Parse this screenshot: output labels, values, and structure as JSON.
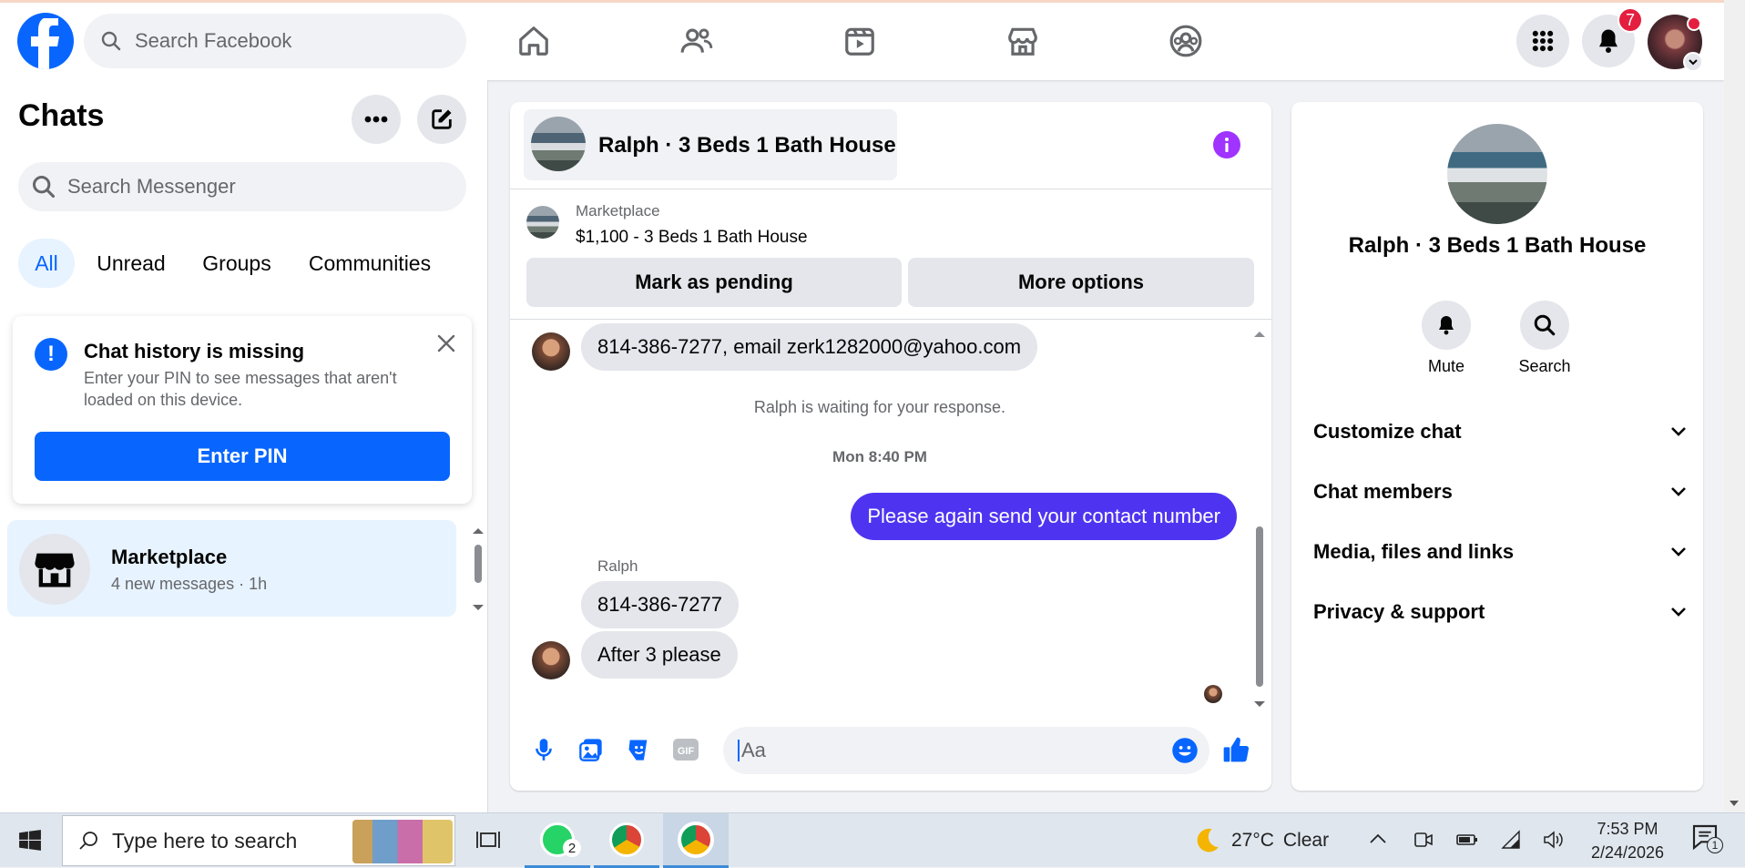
{
  "topbar": {
    "search_placeholder": "Search Facebook",
    "notification_count": "7",
    "nav": [
      "home-icon",
      "friends-icon",
      "watch-icon",
      "marketplace-icon",
      "groups-icon"
    ]
  },
  "chats": {
    "title": "Chats",
    "search_placeholder": "Search Messenger",
    "filters": [
      "All",
      "Unread",
      "Groups",
      "Communities"
    ],
    "notice": {
      "title": "Chat history is missing",
      "body": "Enter your PIN to see messages that aren't loaded on this device.",
      "button": "Enter PIN"
    },
    "items": [
      {
        "name": "Marketplace",
        "preview": "4 new messages · 1h"
      }
    ]
  },
  "conversation": {
    "title": "Ralph · 3 Beds 1 Bath House",
    "listing_label": "Marketplace",
    "listing_title": "$1,100 - 3 Beds 1 Bath House",
    "mark_pending": "Mark as pending",
    "more_options": "More options",
    "messages": {
      "m1": "814-386-7277, email zerk1282000@yahoo.com",
      "waiting": "Ralph is waiting for your response.",
      "timestamp": "Mon 8:40 PM",
      "sent": "Please again send your contact number",
      "sender": "Ralph",
      "m2": "814-386-7277",
      "m3": "After 3 please"
    },
    "composer_placeholder": "Aa"
  },
  "details": {
    "name": "Ralph · 3 Beds 1 Bath House",
    "mute": "Mute",
    "search": "Search",
    "sections": [
      "Customize chat",
      "Chat members",
      "Media, files and links",
      "Privacy & support"
    ]
  },
  "taskbar": {
    "search_placeholder": "Type here to search",
    "weather_temp": "27°C",
    "weather_text": "Clear",
    "time": "7:53 PM",
    "date": "2/24/2026",
    "notif_count": "1",
    "whatsapp_badge": "2"
  },
  "colors": {
    "fb_blue": "#0866ff",
    "sent_bubble": "#4e34f1",
    "info_purple": "#a033ff",
    "badge_red": "#e41e3f"
  }
}
